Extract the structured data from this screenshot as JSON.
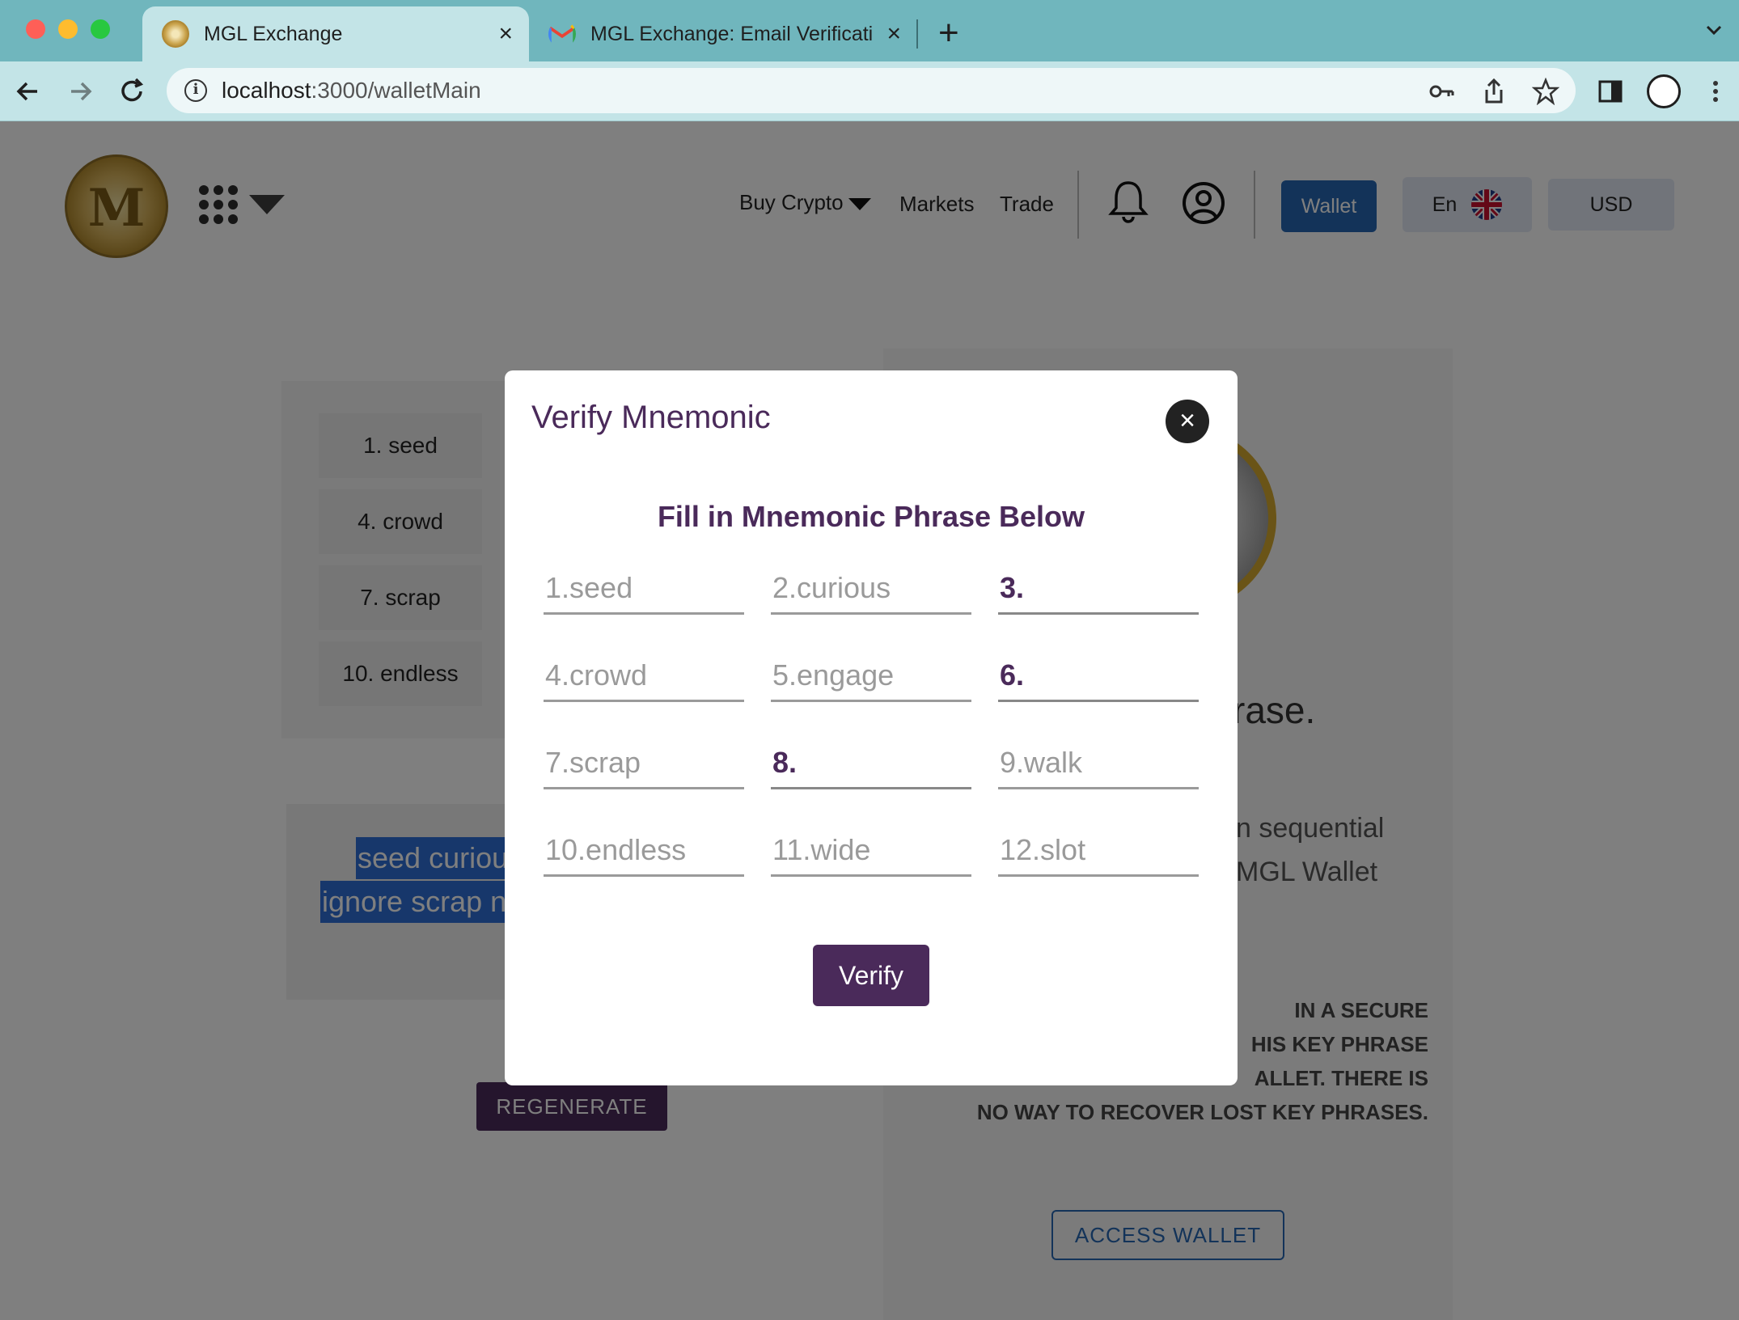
{
  "browser": {
    "tabs": [
      {
        "title": "MGL Exchange",
        "active": true
      },
      {
        "title": "MGL Exchange: Email Verificati",
        "active": false
      }
    ],
    "url_host": "localhost",
    "url_path": ":3000/walletMain"
  },
  "header": {
    "buy_crypto": "Buy Crypto",
    "markets": "Markets",
    "trade": "Trade",
    "wallet": "Wallet",
    "lang": "En",
    "currency": "USD"
  },
  "background": {
    "word_cells": [
      "1. seed",
      "4. crowd",
      "7. scrap",
      "10. endless"
    ],
    "phrase_line1": "seed curiou",
    "phrase_line2": "ignore scrap n",
    "regenerate": "REGENERATE",
    "heading_fragment": "rase.",
    "desc_line1": "n sequential",
    "desc_line2": "MGL Wallet",
    "warn_line1": "IN A SECURE",
    "warn_line2": "HIS KEY PHRASE",
    "warn_line3": "ALLET. THERE IS",
    "warn_line4": "NO WAY TO RECOVER LOST KEY PHRASES.",
    "access_wallet": "ACCESS WALLET"
  },
  "modal": {
    "title": "Verify Mnemonic",
    "close": "×",
    "subtitle": "Fill in Mnemonic Phrase Below",
    "fields": [
      {
        "text": "1.seed",
        "blank": false
      },
      {
        "text": "2.curious",
        "blank": false
      },
      {
        "text": "3.",
        "blank": true
      },
      {
        "text": "4.crowd",
        "blank": false
      },
      {
        "text": "5.engage",
        "blank": false
      },
      {
        "text": "6.",
        "blank": true
      },
      {
        "text": "7.scrap",
        "blank": false
      },
      {
        "text": "8.",
        "blank": true
      },
      {
        "text": "9.walk",
        "blank": false
      },
      {
        "text": "10.endless",
        "blank": false
      },
      {
        "text": "11.wide",
        "blank": false
      },
      {
        "text": "12.slot",
        "blank": false
      }
    ],
    "verify": "Verify"
  },
  "colors": {
    "accent_purple": "#4a2a5a",
    "wallet_blue": "#2667b2",
    "tab_bar": "#70b6bd"
  }
}
